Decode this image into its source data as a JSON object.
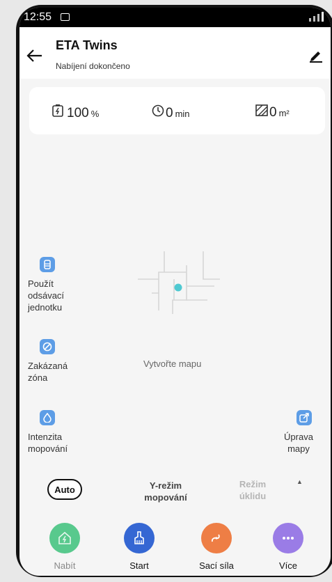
{
  "status_bar": {
    "time": "12:55"
  },
  "header": {
    "title": "ETA Twins",
    "subtitle": "Nabíjení dokončeno"
  },
  "stats": {
    "battery": {
      "value": "100",
      "unit": "%"
    },
    "time": {
      "value": "0",
      "unit": "min"
    },
    "area": {
      "value": "0",
      "unit": "m²"
    }
  },
  "tools": {
    "suction_unit": "Použít odsávací jednotku",
    "forbidden_zone": "Zakázaná zóna",
    "mop_intensity": "Intenzita mopování",
    "edit_map": "Úprava mapy"
  },
  "map": {
    "message": "Vytvořte mapu"
  },
  "modes": {
    "auto": "Auto",
    "y_mode": "Y-režim mopování",
    "clean_mode": "Režim úklidu"
  },
  "actions": {
    "charge": "Nabít",
    "start": "Start",
    "suction": "Sací síla",
    "more": "Více"
  },
  "colors": {
    "charge": "#58c98d",
    "start": "#3567d3",
    "suction": "#ee7e45",
    "more": "#9a7ce6",
    "tool_icon": "#5d9de6",
    "robot_dot": "#4fc9d1"
  }
}
